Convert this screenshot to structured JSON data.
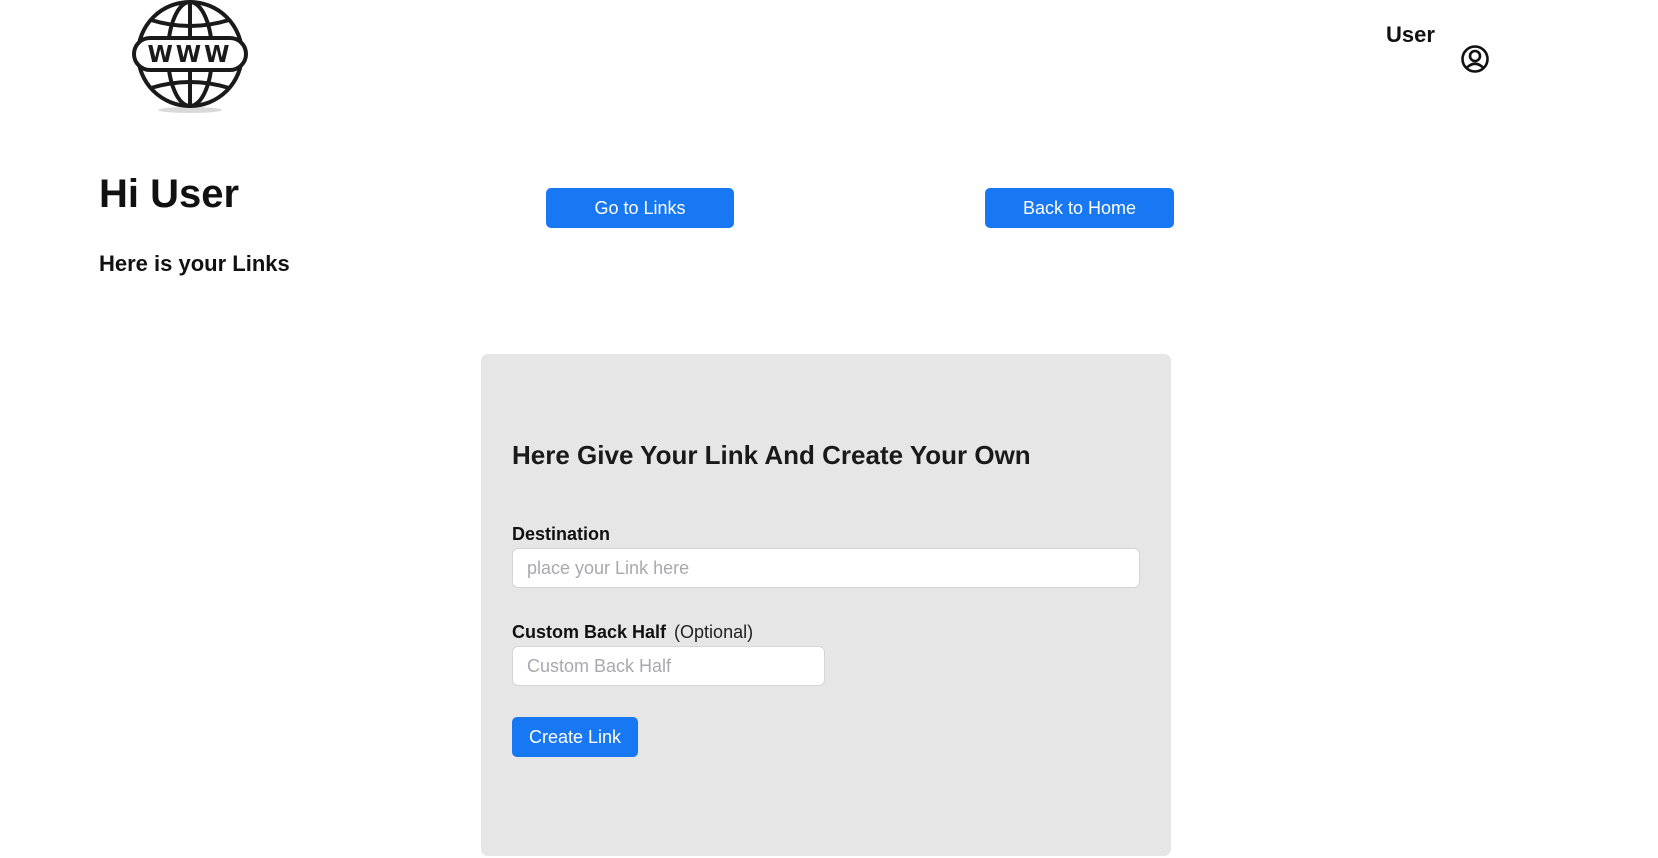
{
  "header": {
    "logo": {
      "icon": "globe-www-icon",
      "text": "WWW"
    },
    "user": {
      "name": "User",
      "icon": "user-circle-icon"
    }
  },
  "intro": {
    "greeting": "Hi User",
    "subheading": "Here is your Links"
  },
  "nav": {
    "go_to_links": "Go to Links",
    "back_to_home": "Back to Home"
  },
  "form": {
    "title": "Here Give Your Link And Create Your Own",
    "destination": {
      "label": "Destination",
      "placeholder": "place your Link here",
      "value": ""
    },
    "custom_back_half": {
      "label": "Custom Back Half",
      "note": "(Optional)",
      "placeholder": "Custom Back Half",
      "value": ""
    },
    "submit_label": "Create Link"
  },
  "colors": {
    "primary": "#1877f2",
    "card_bg": "#e6e6e7",
    "text": "#111111"
  }
}
